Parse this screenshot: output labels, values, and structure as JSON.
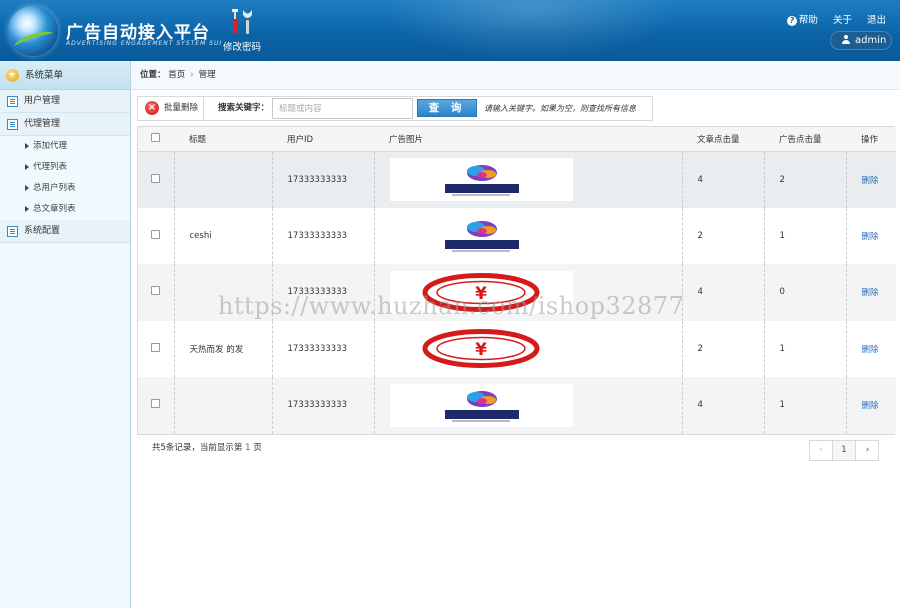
{
  "header": {
    "title": "广告自动接入平台",
    "subtitle": "ADVERTISING ENGAGEMENT SYSTEM SUI",
    "change_password": "修改密码",
    "links": {
      "help": "帮助",
      "about": "关于",
      "logout": "退出"
    },
    "user": "admin"
  },
  "sidebar": {
    "title": "系统菜单",
    "sections": [
      {
        "label": "用户管理"
      },
      {
        "label": "代理管理"
      },
      {
        "label": "系统配置"
      }
    ],
    "items": [
      "添加代理",
      "代理列表",
      "总用户列表",
      "总文章列表"
    ]
  },
  "breadcrumb": {
    "label": "位置：",
    "home": "首页",
    "current": "管理"
  },
  "toolbar": {
    "batch_delete": "批量删除",
    "search_label": "搜索关键字：",
    "search_placeholder": "标题或内容",
    "search_button": "查 询",
    "hint": "请输入关键字。如果为空，则查找所有信息"
  },
  "table": {
    "headers": [
      "标题",
      "用户ID",
      "广告图片",
      "文章点击量",
      "广告点击量",
      "操作"
    ],
    "rows": [
      {
        "title": "",
        "user_id": "17333333333",
        "image": "logo",
        "article_clicks": "4",
        "ad_clicks": "2",
        "action": "删除"
      },
      {
        "title": "ceshi",
        "user_id": "17333333333",
        "image": "logo",
        "article_clicks": "2",
        "ad_clicks": "1",
        "action": "删除"
      },
      {
        "title": "",
        "user_id": "17333333333",
        "image": "yen",
        "article_clicks": "4",
        "ad_clicks": "0",
        "action": "删除"
      },
      {
        "title": "天热而发 的发",
        "user_id": "17333333333",
        "image": "yen",
        "article_clicks": "2",
        "ad_clicks": "1",
        "action": "删除"
      },
      {
        "title": "",
        "user_id": "17333333333",
        "image": "logo",
        "article_clicks": "4",
        "ad_clicks": "1",
        "action": "删除"
      }
    ]
  },
  "footer": {
    "text_pre": "共5条记录，当前显示第 ",
    "page": "1",
    "text_post": " 页"
  },
  "pager": {
    "prev": "‹",
    "current": "1",
    "next": "›"
  },
  "watermark": "https://www.huzhan.com/ishop32877",
  "colors": {
    "header": "#0b64a8",
    "sidebar_bg": "#f0f9fd",
    "link": "#2a6ebd",
    "delete_red": "#c81414"
  }
}
